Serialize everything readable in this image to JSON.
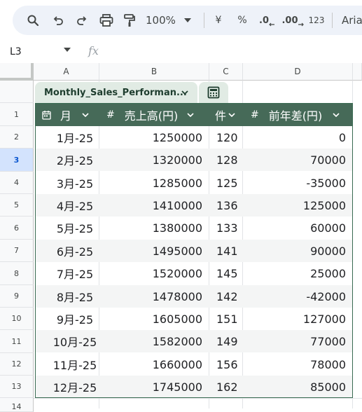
{
  "toolbar": {
    "zoom": "100%",
    "currency_label": "¥",
    "percent_label": "%",
    "decrease_decimal_label": ".0",
    "increase_decimal_label": ".00",
    "number_format_label": "123",
    "font_label": "Aria"
  },
  "formula_bar": {
    "cell_ref": "L3",
    "fx_label": "fx"
  },
  "columns": [
    "A",
    "B",
    "C",
    "D"
  ],
  "rows": [
    "1",
    "2",
    "3",
    "4",
    "5",
    "6",
    "7",
    "8",
    "9",
    "10",
    "11",
    "12",
    "13",
    "14"
  ],
  "selected_row": "3",
  "table": {
    "name": "Monthly_Sales_Performan...",
    "headers": [
      {
        "label": "月",
        "type_icon": "calendar-icon"
      },
      {
        "label": "売上高(円)",
        "type_symbol": "#"
      },
      {
        "label": "件",
        "type_symbol": ""
      },
      {
        "label": "前年差(円)",
        "type_symbol": "#"
      }
    ],
    "rows": [
      [
        "1月-25",
        "1250000",
        "120",
        "0"
      ],
      [
        "2月-25",
        "1320000",
        "128",
        "70000"
      ],
      [
        "3月-25",
        "1285000",
        "125",
        "-35000"
      ],
      [
        "4月-25",
        "1410000",
        "136",
        "125000"
      ],
      [
        "5月-25",
        "1380000",
        "133",
        "60000"
      ],
      [
        "6月-25",
        "1495000",
        "141",
        "90000"
      ],
      [
        "7月-25",
        "1520000",
        "145",
        "25000"
      ],
      [
        "8月-25",
        "1478000",
        "142",
        "-42000"
      ],
      [
        "9月-25",
        "1605000",
        "151",
        "127000"
      ],
      [
        "10月-25",
        "1582000",
        "149",
        "77000"
      ],
      [
        "11月-25",
        "1660000",
        "156",
        "78000"
      ],
      [
        "12月-25",
        "1745000",
        "162",
        "85000"
      ]
    ]
  },
  "colors": {
    "table_header_bg": "#466a58",
    "table_tab_bg": "#e1ebe4",
    "selected_row_bg": "#d3e3fd"
  }
}
